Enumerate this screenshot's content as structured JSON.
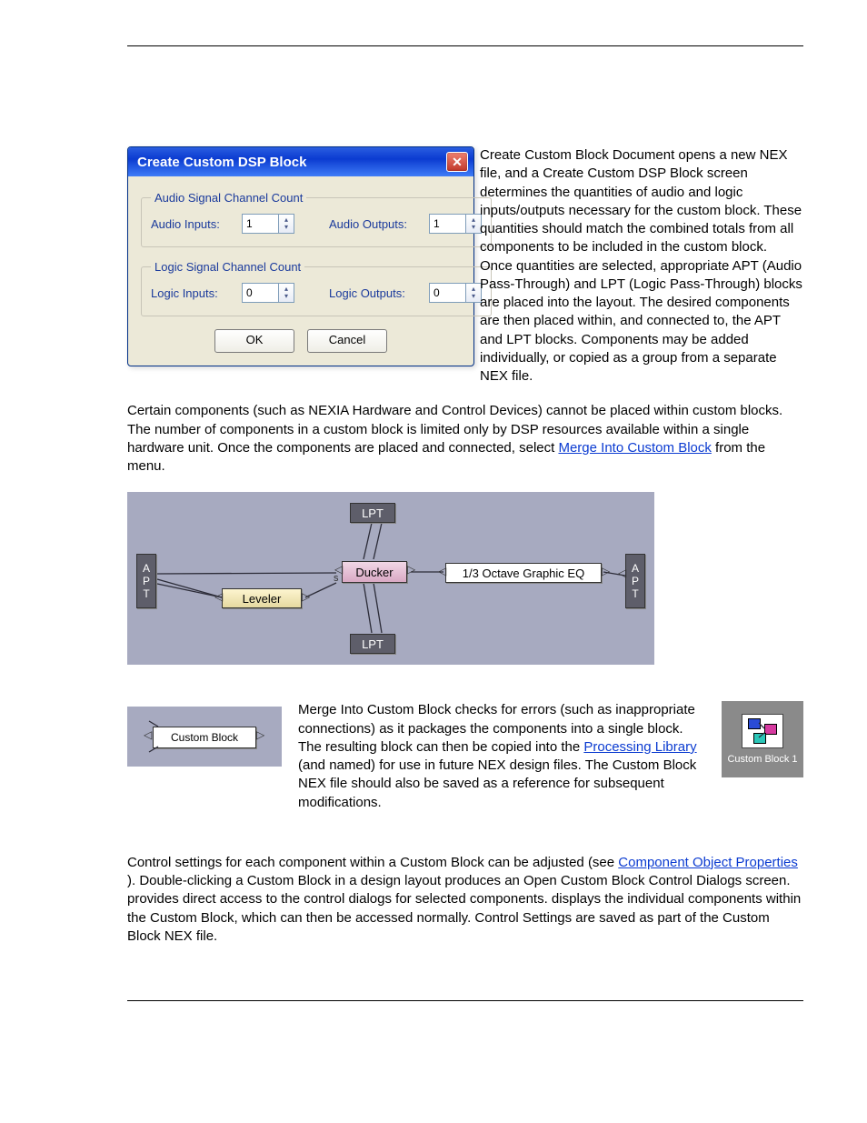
{
  "dialog": {
    "title": "Create Custom DSP Block",
    "close_glyph": "✕",
    "group_audio": {
      "legend": "Audio Signal Channel Count",
      "inputs_label": "Audio Inputs:",
      "inputs_value": "1",
      "outputs_label": "Audio Outputs:",
      "outputs_value": "1"
    },
    "group_logic": {
      "legend": "Logic Signal Channel Count",
      "inputs_label": "Logic Inputs:",
      "inputs_value": "0",
      "outputs_label": "Logic Outputs:",
      "outputs_value": "0"
    },
    "ok_label": "OK",
    "cancel_label": "Cancel"
  },
  "text": {
    "para1": "Create Custom Block Document opens a new NEX file, and a Create Custom DSP Block screen determines the quantities of audio and logic inputs/outputs necessary for the custom block. These quantities should match the combined totals from all components to be included in the custom block. Once quantities are selected, appropriate APT (Audio Pass-Through) and LPT (Logic Pass-Through) blocks are placed into the layout. The desired components are then placed within, and connected to, the APT and LPT blocks. Components may be added individually, or copied as a group from a separate NEX file.",
    "para2_a": "Certain components (such as NEXIA Hardware and Control Devices) cannot be placed within custom blocks. The number of components in a custom block is limited only by DSP resources available within a single hardware unit. Once the components are placed and connected, select ",
    "merge_link": "Merge Into Custom Block",
    "para2_b": " from the menu.",
    "para3_a": "Merge Into Custom Block checks for errors (such as inappropriate connections) as it packages the components into a single block. The resulting block can then be copied into the ",
    "proc_lib_link": "Processing Library",
    "para3_b": " (and named) for use in future NEX design files. The Custom Block NEX file should also be saved as a reference for subsequent modifications.",
    "para4_a": "Control settings for each component within a Custom Block can be adjusted (see ",
    "comp_link": "Component Object Properties",
    "para4_b": "). Double-clicking a Custom Block in a design layout produces an Open Custom Block Control Dialogs screen. ",
    "para4_c": " provides direct access to the control dialogs for selected components. ",
    "para4_d": " displays the individual components within the Custom Block, which can then be accessed normally. Control Settings are saved as part of the Custom Block NEX file."
  },
  "diagram": {
    "lpt": "LPT",
    "apt": "A\nP\nT",
    "leveler": "Leveler",
    "ducker": "Ducker",
    "ducker_s": "s",
    "geq": "1/3 Octave Graphic EQ"
  },
  "custom_block": {
    "label": "Custom Block",
    "right_label": "Custom Block 1"
  }
}
